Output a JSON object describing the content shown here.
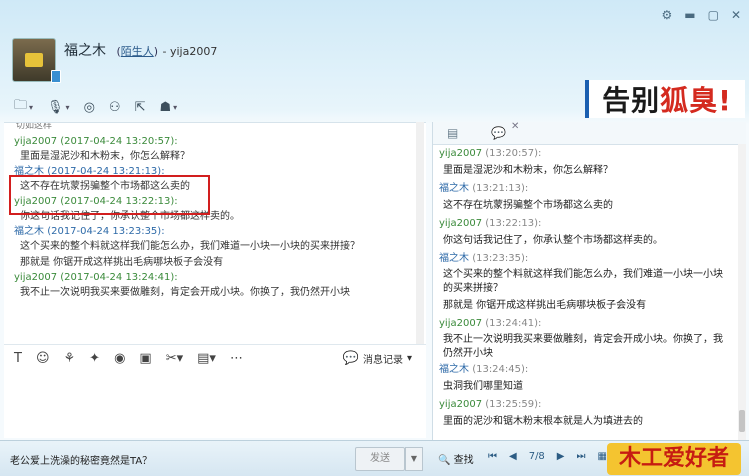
{
  "contact": {
    "name": "福之木",
    "tag": "陌生人",
    "account": "- yija2007"
  },
  "ad_banner": {
    "part1": "告别",
    "part2": "狐臭!"
  },
  "left_chat": {
    "cut_text": "切如这样",
    "messages": [
      {
        "sender": "yija2007",
        "time": "(2017-04-24 13:20:57):",
        "lines": [
          "里面是湿泥沙和木粉末，你怎么解释？"
        ]
      },
      {
        "sender": "福之木",
        "time": "(2017-04-24 13:21:13):",
        "lines": [
          "这不存在坑蒙拐骗整个市场都这么卖的"
        ]
      },
      {
        "sender": "yija2007",
        "time": "(2017-04-24 13:22:13):",
        "lines": [
          "你这句话我记住了，你承认整个市场都这样卖的。"
        ]
      },
      {
        "sender": "福之木",
        "time": "(2017-04-24 13:23:35):",
        "lines": [
          "这个买来的整个料就这样我们能怎么办，我们难道一小块一小块的买来拼接？",
          "那就是 你锯开成这样挑出毛病哪块板子会没有"
        ]
      },
      {
        "sender": "yija2007",
        "time": "(2017-04-24 13:24:41):",
        "lines": [
          "我不止一次说明我买来要做雕刻，肯定会开成小块。你换了，我仍然开小块"
        ]
      }
    ]
  },
  "format_bar": {
    "records_label": "消息记录"
  },
  "bottom": {
    "ad_text": "老公爱上洗澡的秘密竟然是TA？",
    "send_label": "发送",
    "search_label": "查找",
    "page": "7/8",
    "logo_text": "木工爱好者"
  },
  "right_chat": {
    "messages": [
      {
        "sender": "yija2007",
        "time": "(13:20:57):",
        "lines": [
          "里面是湿泥沙和木粉末，你怎么解释？"
        ]
      },
      {
        "sender": "福之木",
        "time": "(13:21:13):",
        "lines": [
          "这不存在坑蒙拐骗整个市场都这么卖的"
        ]
      },
      {
        "sender": "yija2007",
        "time": "(13:22:13):",
        "lines": [
          "你这句话我记住了，你承认整个市场都这样卖的。"
        ]
      },
      {
        "sender": "福之木",
        "time": "(13:23:35):",
        "lines": [
          "这个买来的整个料就这样我们能怎么办，我们难道一小块一小块",
          "的买来拼接？",
          "那就是 你锯开成这样挑出毛病哪块板子会没有"
        ]
      },
      {
        "sender": "yija2007",
        "time": "(13:24:41):",
        "lines": [
          "我不止一次说明我买来要做雕刻，肯定会开成小块。你换了，我",
          "仍然开小块"
        ]
      },
      {
        "sender": "福之木",
        "time": "(13:24:45):",
        "lines": [
          "虫洞我们哪里知道"
        ]
      },
      {
        "sender": "yija2007",
        "time": "(13:25:59):",
        "lines": [
          "里面的泥沙和锯木粉末根本就是人为填进去的"
        ]
      }
    ]
  }
}
